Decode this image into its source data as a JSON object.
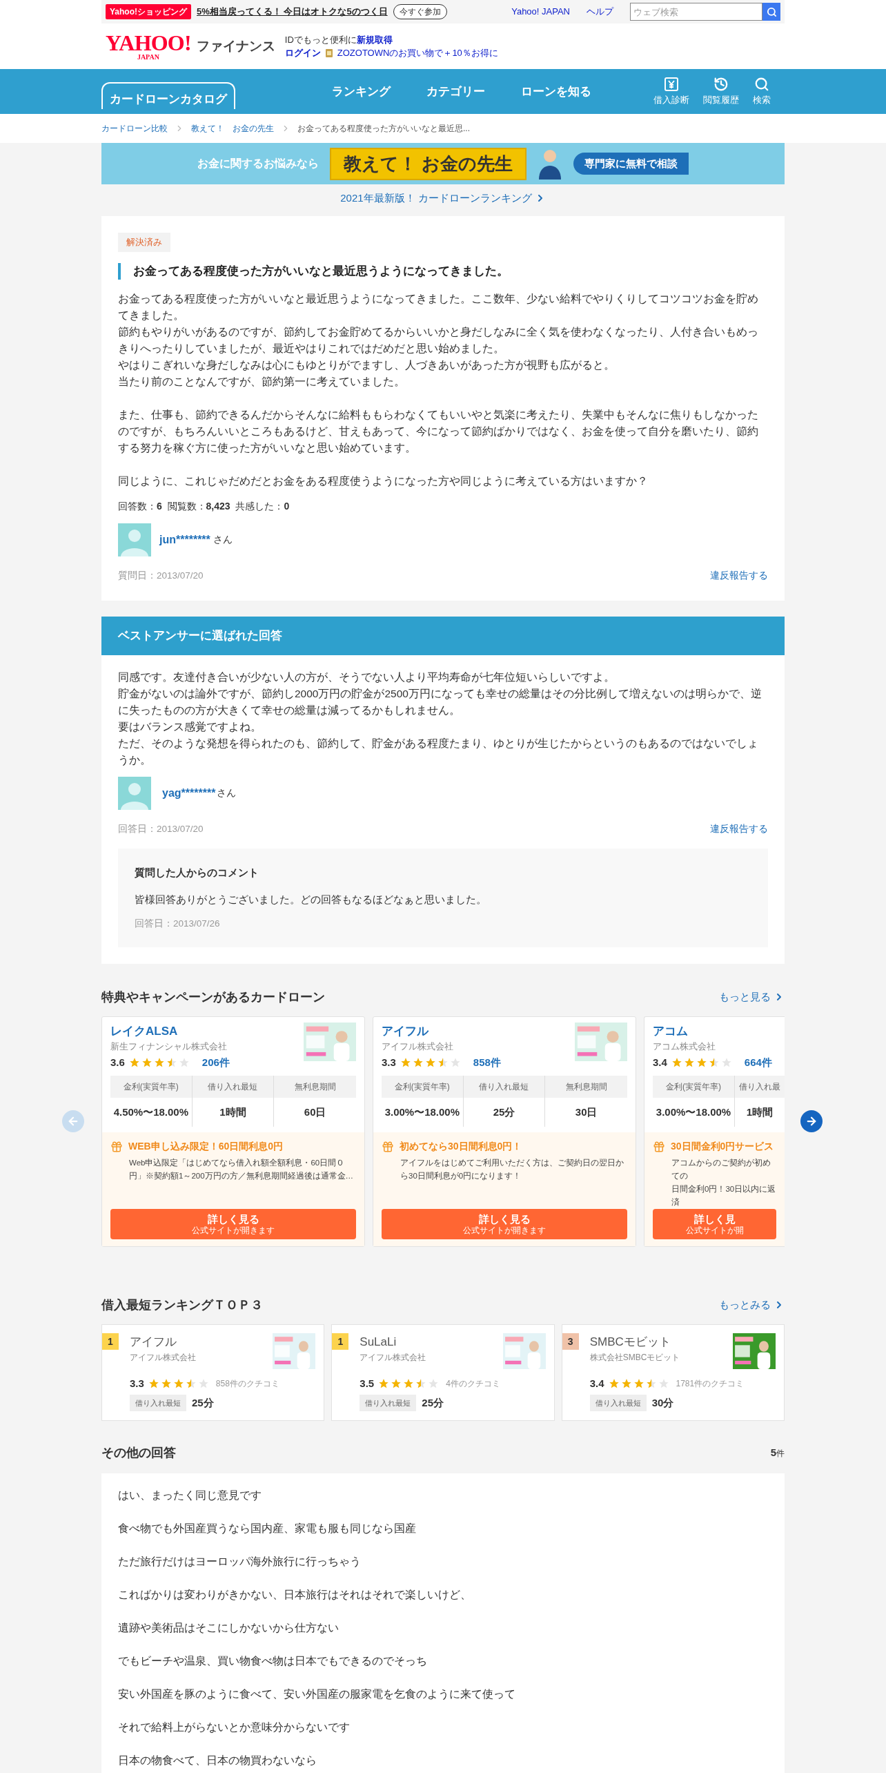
{
  "topbar": {
    "promo_badge": "Yahoo!ショッピング",
    "promo_text": "5%相当戻ってくる！ 今日はオトクな5のつく日",
    "promo_button": "今すぐ参加",
    "links": [
      "Yahoo! JAPAN",
      "ヘルプ"
    ],
    "search_placeholder": "ウェブ検索"
  },
  "header": {
    "logo": "YAHOO!",
    "logo_sub": "JAPAN",
    "service": "ファイナンス",
    "signup_prefix": "IDでもっと便利に",
    "signup_link": "新規取得",
    "login": "ログイン",
    "zozo": "ZOZOTOWNのお買い物で＋10％お得に"
  },
  "nav": {
    "brand": "カードローンカタログ",
    "items": [
      "ランキング",
      "カテゴリー",
      "ローンを知る"
    ],
    "icons": [
      {
        "kind": "yen",
        "label": "借入診断"
      },
      {
        "kind": "history",
        "label": "閲覧履歴"
      },
      {
        "kind": "search",
        "label": "検索"
      }
    ]
  },
  "breadcrumb": [
    {
      "label": "カードローン比較",
      "link": true
    },
    {
      "label": "教えて！　お金の先生",
      "link": true
    },
    {
      "label": "お金ってある程度使った方がいいなと最近思...",
      "link": false
    }
  ],
  "banner": {
    "lead": "お金に関するお悩みなら",
    "title": "教えて！ お金の先生",
    "cta": "専門家に無料で相談"
  },
  "ranking_link": "2021年最新版！ カードローンランキング",
  "question": {
    "status": "解決済み",
    "title": "お金ってある程度使った方がいいなと最近思うようになってきました。",
    "paragraphs": [
      [
        "お金ってある程度使った方がいいなと最近思うようになってきました。ここ数年、少ない給料でやりくりしてコツコツお金を貯めてきました。",
        "節約もやりがいがあるのですが、節約してお金貯めてるからいいかと身だしなみに全く気を使わなくなったり、人付き合いもめっきりへったりしていましたが、最近やはりこれではだめだと思い始めました。",
        "やはりこぎれいな身だしなみは心にもゆとりがでますし、人づきあいがあった方が視野も広がると。",
        "当たり前のことなんですが、節約第一に考えていました。"
      ],
      [
        "また、仕事も、節約できるんだからそんなに給料ももらわなくてもいいやと気楽に考えたり、失業中もそんなに焦りもしなかったのですが、もちろんいいところもあるけど、甘えもあって、今になって節約ばかりではなく、お金を使って自分を磨いたり、節約する努力を稼ぐ方に使った方がいいなと思い始めています。"
      ],
      [
        "同じように、これじゃだめだとお金をある程度使うようになった方や同じように考えている方はいますか？"
      ]
    ],
    "stats": "回答数：**6**  閲覧数：**8,423**  共感した：**0**",
    "user": "jun********",
    "honorific": "さん",
    "date": "質問日：2013/07/20",
    "report": "違反報告する"
  },
  "best_answer": {
    "heading": "ベストアンサーに選ばれた回答",
    "paragraphs": [
      [
        "同感です。友達付き合いが少ない人の方が、そうでない人より平均寿命が七年位短いらしいですよ。",
        "貯金がないのは論外ですが、節約し2000万円の貯金が2500万円になっても幸せの総量はその分比例して増えないのは明らかで、逆に失ったものの方が大きくて幸せの総量は減ってるかもしれません。",
        "要はバランス感覚ですよね。",
        "ただ、そのような発想を得られたのも、節約して、貯金がある程度たまり、ゆとりが生じたからというのもあるのではないでしょうか。"
      ]
    ],
    "user": "yag********",
    "honorific": "さん",
    "date": "回答日：2013/07/20",
    "report": "違反報告する",
    "comment": {
      "title": "質問した人からのコメント",
      "text": "皆様回答ありがとうございました。どの回答もなるほどなぁと思いました。",
      "date": "回答日：2013/07/26"
    }
  },
  "campaign": {
    "title": "特典やキャンペーンがあるカードローン",
    "more": "もっと見る",
    "prev_disabled": true,
    "next_disabled": false,
    "cards": [
      {
        "name": "レイクALSA",
        "company": "新生フィナンシャル株式会社",
        "rating": "3.6",
        "stars": 3.5,
        "reviews": "206件",
        "columns": [
          {
            "header": "金利(実質年率)",
            "value": "4.50%〜18.00%"
          },
          {
            "header": "借り入れ最短",
            "value": "1時間"
          },
          {
            "header": "無利息期間",
            "value": "60日"
          }
        ],
        "promo_title": "WEB申し込み限定！60日間利息0円",
        "promo_text": [
          "Web申込限定「はじめてなら借入れ額全額利息・60日間０円」※契約額1～200万円の方／無利息期間経過後は通常金…"
        ],
        "button": "詳しく見る",
        "button_sub": "公式サイトが開きます",
        "thumbnail": {
          "kind": "picture"
        }
      },
      {
        "name": "アイフル",
        "company": "アイフル株式会社",
        "rating": "3.3",
        "stars": 3.5,
        "reviews": "858件",
        "columns": [
          {
            "header": "金利(実質年率)",
            "value": "3.00%〜18.00%"
          },
          {
            "header": "借り入れ最短",
            "value": "25分"
          },
          {
            "header": "無利息期間",
            "value": "30日"
          }
        ],
        "promo_title": "初めてなら30日間利息0円！",
        "promo_text": [
          "アイフルをはじめてご利用いただく方は、ご契約日の翌日から30日間利息が0円になります！"
        ],
        "button": "詳しく見る",
        "button_sub": "公式サイトが開きます",
        "thumbnail": {
          "kind": "picture"
        }
      },
      {
        "name": "アコム",
        "company": "アコム株式会社",
        "rating": "3.4",
        "stars": 3.5,
        "reviews": "664件",
        "columns": [
          {
            "header": "金利(実質年率)",
            "value": "3.00%〜18.00%"
          },
          {
            "header": "借り入れ最",
            "value": "1時間"
          }
        ],
        "promo_title": "30日間金利0円サービス",
        "promo_text": [
          "アコムからのご契約が初めての",
          "日間金利0円！30日以内に返済"
        ],
        "button": "詳しく見",
        "button_sub": "公式サイトが開"
      }
    ]
  },
  "fastest": {
    "title": "借入最短ランキングＴＯＰ３",
    "more": "もっとみる",
    "items": [
      {
        "rank": "1",
        "color": "#fcd34d",
        "name": "アイフル",
        "company": "アイフル株式会社",
        "rating": "3.3",
        "stars": 3.5,
        "reviews": "858件のクチコミ",
        "tag": "借り入れ最短",
        "value": "25分"
      },
      {
        "rank": "1",
        "color": "#fcd34d",
        "name": "SuLaLi",
        "company": "アイフル株式会社",
        "rating": "3.5",
        "stars": 3.5,
        "reviews": "4件のクチコミ",
        "tag": "借り入れ最短",
        "value": "25分"
      },
      {
        "rank": "3",
        "color": "#f0c2a8",
        "name": "SMBCモビット",
        "company": "株式会社SMBCモビット",
        "rating": "3.4",
        "stars": 3.5,
        "reviews": "1781件のクチコミ",
        "tag": "借り入れ最短",
        "value": "30分"
      }
    ]
  },
  "other_answers": {
    "title": "その他の回答",
    "count": "5",
    "unit": "件",
    "lines": [
      "はい、まったく同じ意見です",
      "食べ物でも外国産買うなら国内産、家電も服も同じなら国産",
      "ただ旅行だけはヨーロッパ海外旅行に行っちゃう",
      "こればかりは変わりがきかない、日本旅行はそれはそれで楽しいけど、",
      "遺跡や美術品はそこにしかないから仕方ない",
      "でもビーチや温泉、買い物食べ物は日本でもできるのでそっち",
      "安い外国産を豚のように食べて、安い外国産の服家電を乞食のように来て使って",
      "それで給料上がらないとか意味分からないです",
      "日本の物食べて、日本の物買わないなら"
    ]
  }
}
